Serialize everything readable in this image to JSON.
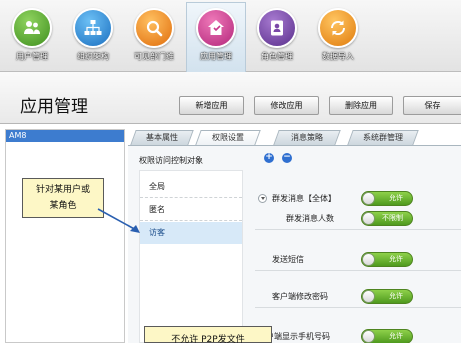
{
  "nav": {
    "items": [
      {
        "label": "用户管理",
        "icon": "users-icon",
        "color": "#58a933"
      },
      {
        "label": "组织架构",
        "icon": "org-chart-icon",
        "color": "#2f8fd8"
      },
      {
        "label": "可见部门维",
        "icon": "magnifier-icon",
        "color": "#f28c1e"
      },
      {
        "label": "应用管理",
        "icon": "app-manage-icon",
        "color": "#c93a8c"
      },
      {
        "label": "角色管理",
        "icon": "contact-card-icon",
        "color": "#7a48a8"
      },
      {
        "label": "数据导入",
        "icon": "refresh-arrows-icon",
        "color": "#f59a1e"
      }
    ]
  },
  "title": "应用管理",
  "toolbar": {
    "add_label": "新增应用",
    "edit_label": "修改应用",
    "delete_label": "删除应用",
    "save_label": "保存"
  },
  "app_list": {
    "selected": "AM8"
  },
  "tabs": [
    {
      "label": "基本属性"
    },
    {
      "label": "权限设置"
    },
    {
      "label": "消息策略"
    },
    {
      "label": "系统群管理"
    }
  ],
  "permissions": {
    "heading": "权限访问控制对象",
    "roles": [
      "全局",
      "匿名",
      "访客"
    ],
    "settings": {
      "group_msg_label": "群发消息【全体】",
      "group_msg_toggle": "允许",
      "group_msg_count_label": "群发消息人数",
      "group_msg_count_toggle": "不限制",
      "sms_label": "发送短信",
      "sms_toggle": "允许",
      "pwd_label": "客户端修改密码",
      "pwd_toggle": "允许",
      "phone_label": "客户端显示手机号码",
      "phone_toggle": "允许"
    }
  },
  "callouts": {
    "note1": "针对某用户或\n某角色",
    "note2": "不允许 P2P发文件"
  },
  "colors": {
    "toggle_green": "#5aa823",
    "selection_blue": "#3d7ccf",
    "role_selected_bg": "#d7e9f8",
    "callout_bg": "#fdf7c6"
  }
}
